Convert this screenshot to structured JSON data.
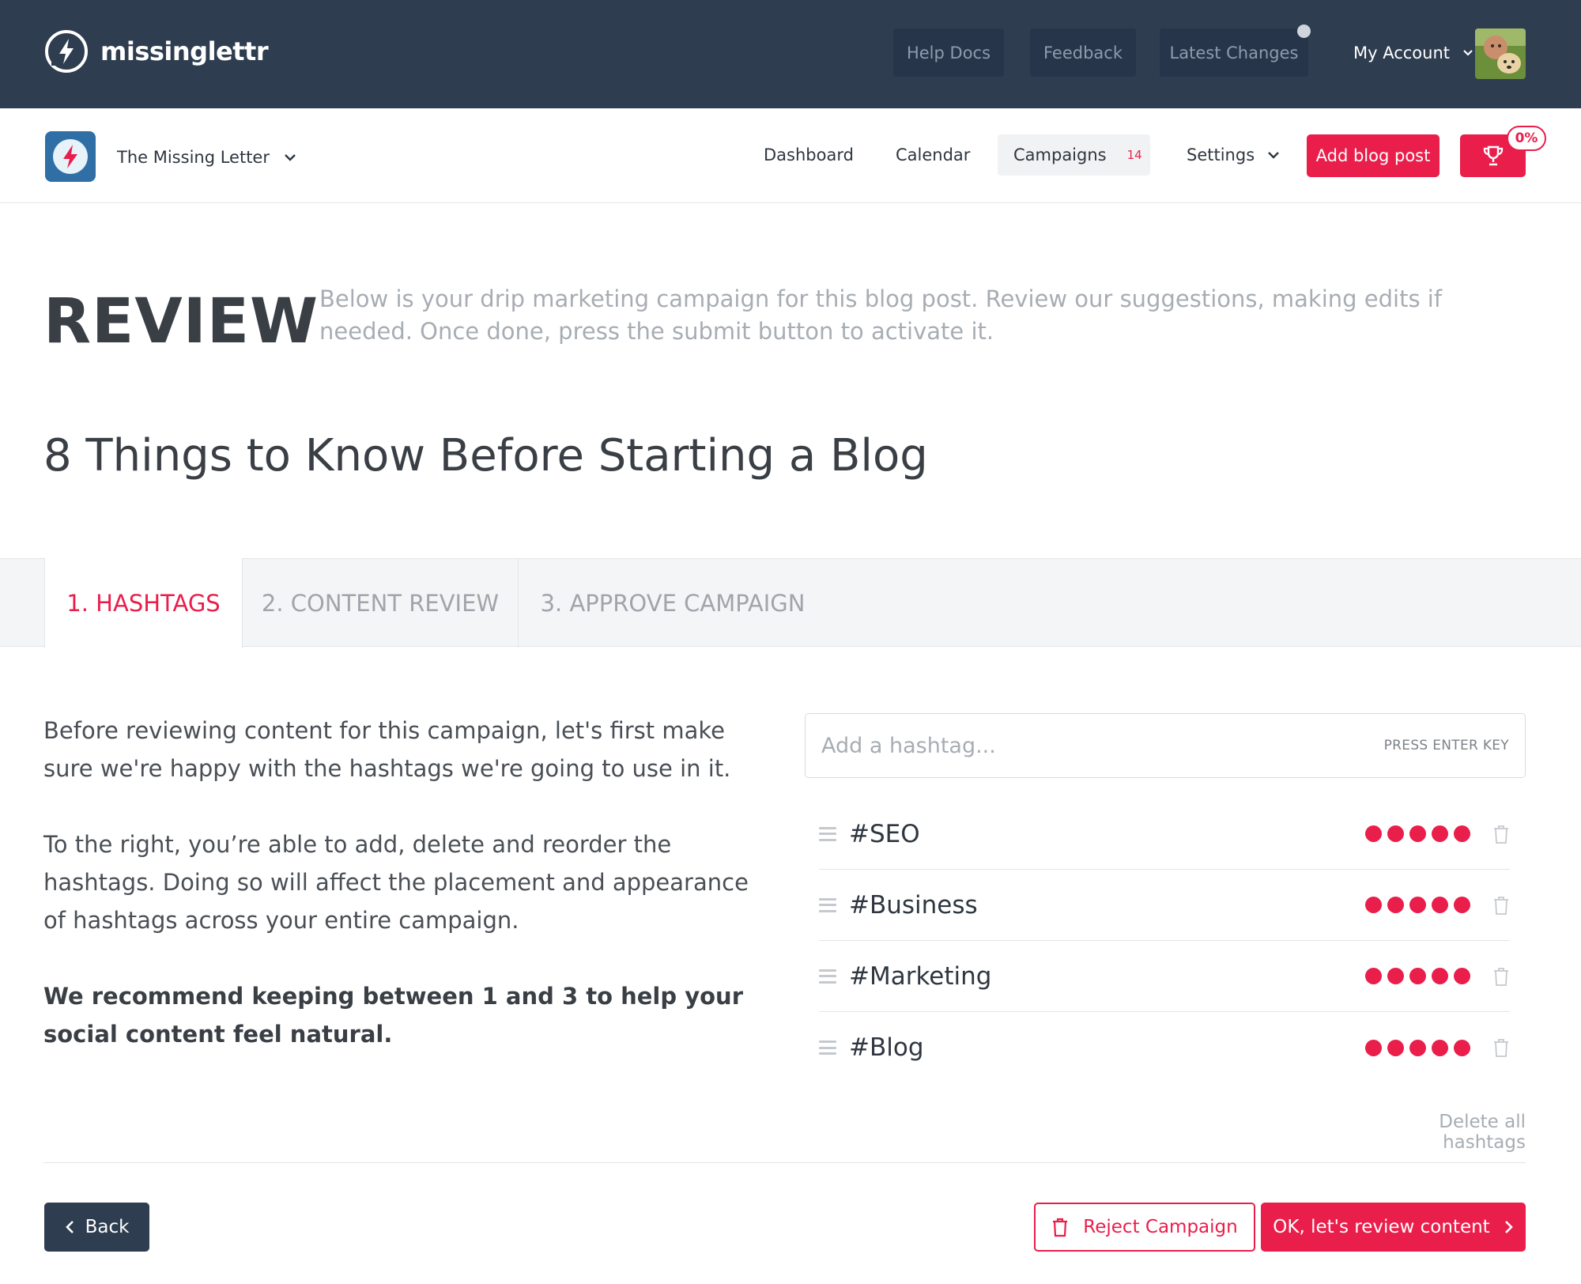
{
  "app": {
    "brand_name": "missinglettr",
    "brand_icon": "bolt-circle-icon"
  },
  "topbar": {
    "help_docs": "Help Docs",
    "feedback": "Feedback",
    "latest_changes": "Latest Changes",
    "account": "My Account"
  },
  "subnav": {
    "site_name": "The Missing Letter",
    "dashboard": "Dashboard",
    "calendar": "Calendar",
    "campaigns": "Campaigns",
    "campaigns_count": "14",
    "settings": "Settings",
    "add_blog_post": "Add blog post",
    "trophy_percent": "0%"
  },
  "page": {
    "heading": "REVIEW",
    "description": "Below is your drip marketing campaign for this blog post. Review our suggestions, making edits if needed. Once done, press the submit button to activate it.",
    "post_title": "8 Things to Know Before Starting a Blog"
  },
  "tabs": [
    {
      "label": "1. HASHTAGS",
      "active": true
    },
    {
      "label": "2. CONTENT REVIEW",
      "active": false
    },
    {
      "label": "3. APPROVE CAMPAIGN",
      "active": false
    }
  ],
  "intro": {
    "p1": "Before reviewing content for this campaign, let's first make sure we're happy with the hashtags we're going to use in it.",
    "p2": "To the right, you’re able to add, delete and reorder the hashtags. Doing so will affect the placement and appearance of hashtags across your entire campaign.",
    "p3": "We recommend keeping between 1 and 3 to help your social content feel natural."
  },
  "hashtags": {
    "placeholder": "Add a hashtag...",
    "hint": "PRESS ENTER KEY",
    "items": [
      {
        "tag": "#SEO",
        "rating": 5
      },
      {
        "tag": "#Business",
        "rating": 5
      },
      {
        "tag": "#Marketing",
        "rating": 5
      },
      {
        "tag": "#Blog",
        "rating": 5
      }
    ],
    "delete_all": "Delete all hashtags"
  },
  "footer": {
    "back": "Back",
    "reject": "Reject Campaign",
    "ok": "OK, let's review content"
  },
  "colors": {
    "topbar": "#2e3d4f",
    "accent": "#ea1e4b",
    "muted_text": "#a8adb3"
  }
}
